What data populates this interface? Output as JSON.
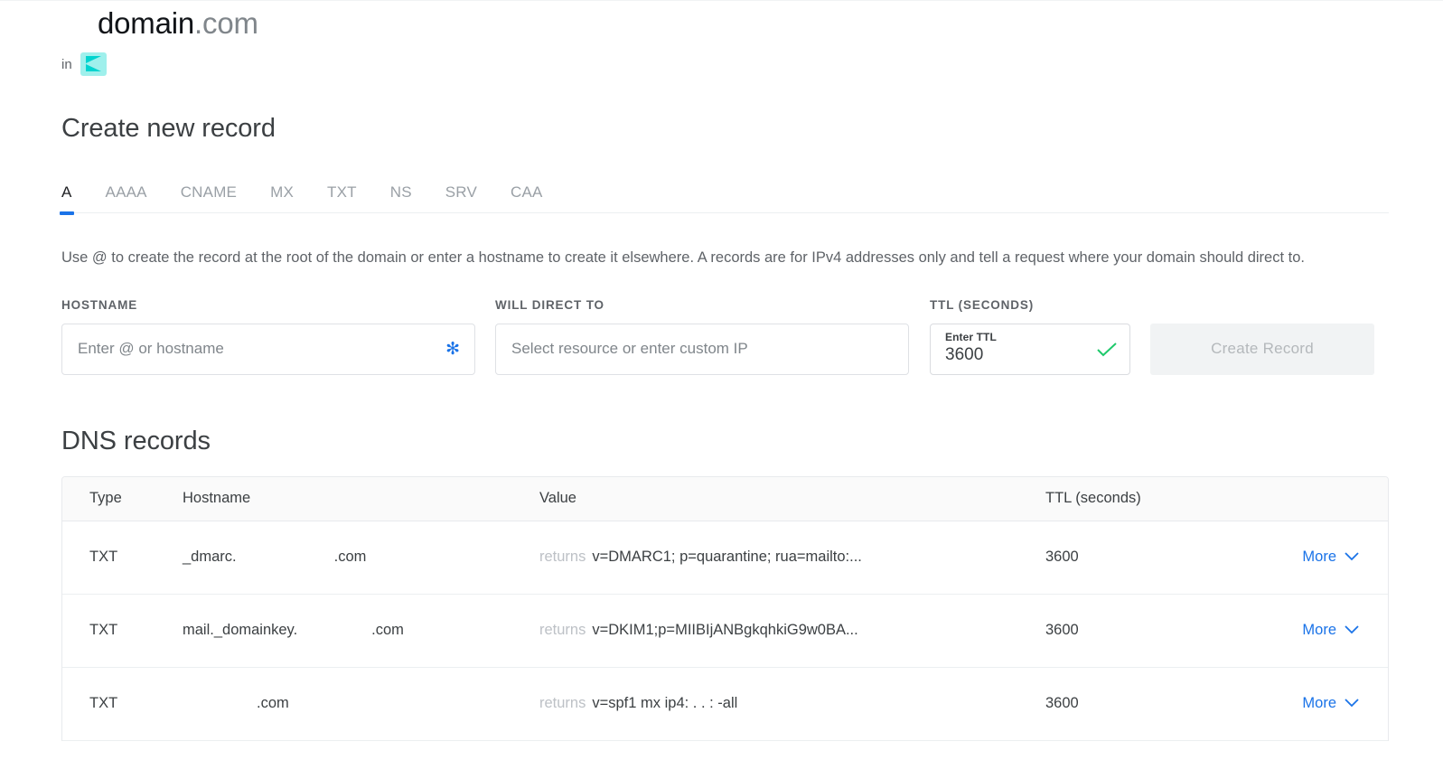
{
  "header": {
    "domain_name": "domain",
    "domain_tld": ".com",
    "in_label": "in",
    "brand_logo_icon": "brand-logo-icon",
    "brand_logo_color": "#9ff0ec",
    "brand_logo_accent": "#00d4cf"
  },
  "create_record": {
    "title": "Create new record",
    "tabs": [
      {
        "label": "A",
        "active": true
      },
      {
        "label": "AAAA",
        "active": false
      },
      {
        "label": "CNAME",
        "active": false
      },
      {
        "label": "MX",
        "active": false
      },
      {
        "label": "TXT",
        "active": false
      },
      {
        "label": "NS",
        "active": false
      },
      {
        "label": "SRV",
        "active": false
      },
      {
        "label": "CAA",
        "active": false
      }
    ],
    "description": "Use @ to create the record at the root of the domain or enter a hostname to create it elsewhere. A records are for IPv4 addresses only and tell a request where your domain should direct to.",
    "hostname": {
      "label": "HOSTNAME",
      "placeholder": "Enter @ or hostname",
      "value": "",
      "required_marker": "✻"
    },
    "will_direct_to": {
      "label": "WILL DIRECT TO",
      "placeholder": "Select resource or enter custom IP",
      "value": ""
    },
    "ttl": {
      "label": "TTL (SECONDS)",
      "float_label": "Enter TTL",
      "value": "3600",
      "valid_icon": "check-icon",
      "valid_color": "#1ec96b"
    },
    "submit": {
      "label": "Create Record",
      "disabled": true
    }
  },
  "dns_records": {
    "title": "DNS records",
    "columns": [
      "Type",
      "Hostname",
      "Value",
      "TTL (seconds)",
      ""
    ],
    "returns_prefix": "returns",
    "more_label": "More",
    "more_icon": "chevron-down-icon",
    "accent_color": "#1a73e8",
    "rows": [
      {
        "type": "TXT",
        "hostname_prefix": "_dmarc.",
        "hostname_redacted_width": 108,
        "hostname_suffix": ".com",
        "value": "v=DMARC1; p=quarantine; rua=mailto:...",
        "ttl": "3600",
        "more": "More"
      },
      {
        "type": "TXT",
        "hostname_prefix": "mail._domainkey.",
        "hostname_redacted_width": 82,
        "hostname_suffix": ".com",
        "value": "v=DKIM1;p=MIIBIjANBgkqhkiG9w0BA...",
        "ttl": "3600",
        "more": "More"
      },
      {
        "type": "TXT",
        "hostname_prefix": "",
        "hostname_redacted_width": 82,
        "hostname_suffix": ".com",
        "value": "v=spf1 mx ip4:      .      .      :      -all",
        "ttl": "3600",
        "more": "More"
      }
    ]
  }
}
